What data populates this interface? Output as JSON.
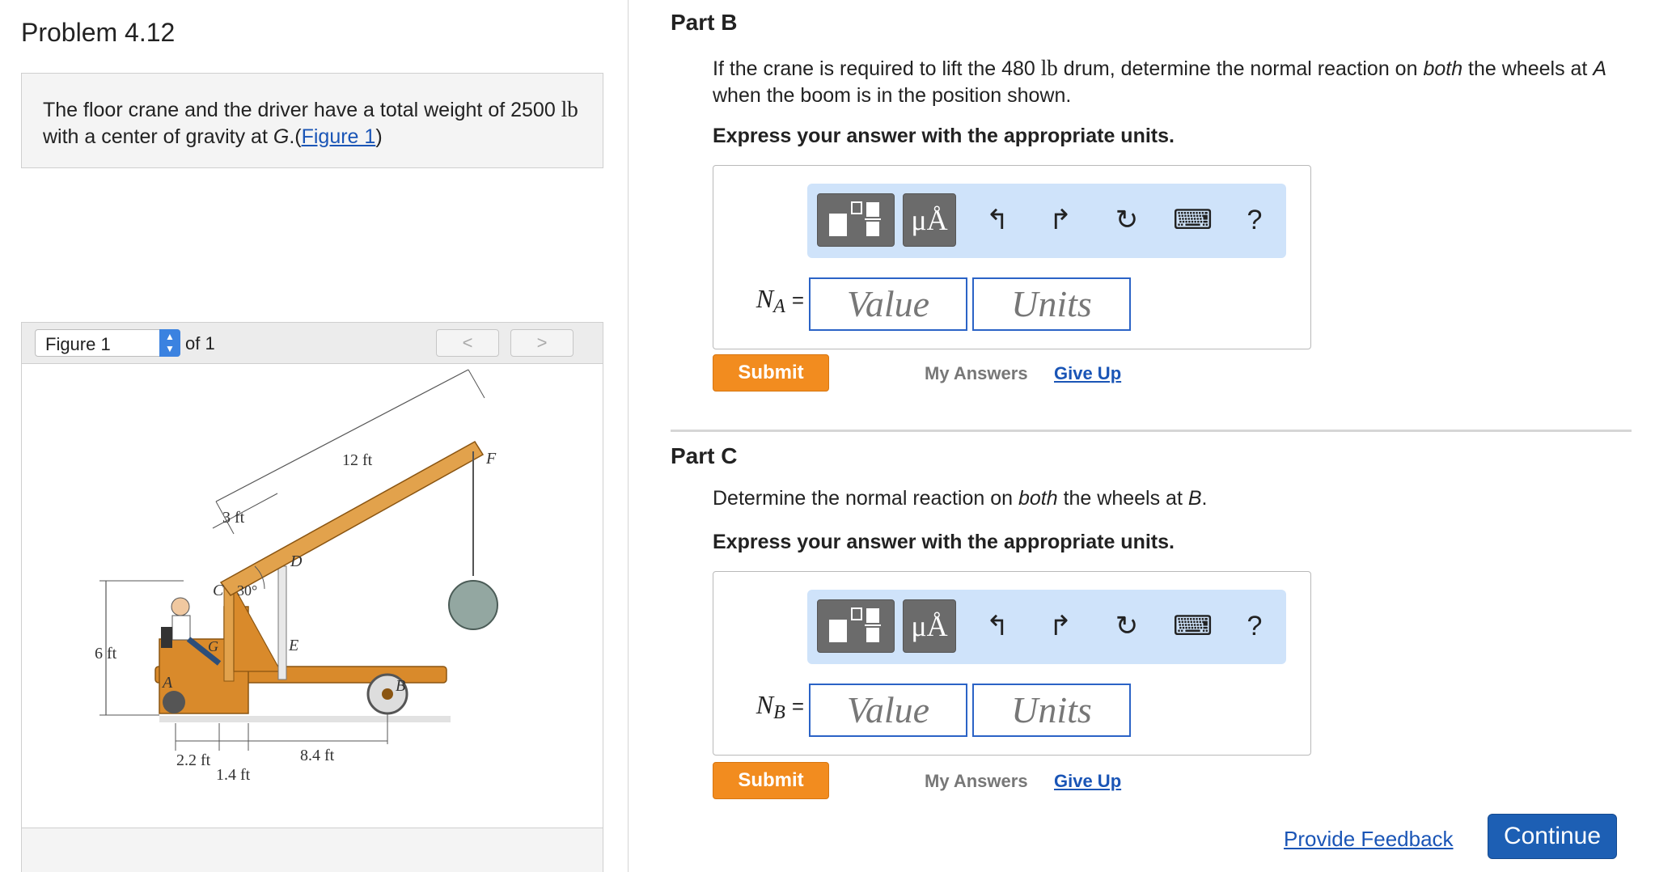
{
  "problem": {
    "title": "Problem 4.12",
    "statement_part1": "The floor crane and the driver have a total weight of 2500",
    "statement_unit": "lb",
    "statement_part2": " with a center of gravity at ",
    "statement_g": "G",
    "statement_part3": ".(",
    "figure_link": "Figure 1",
    "statement_part4": ")"
  },
  "figure_viewer": {
    "selected_figure": "Figure 1",
    "of_label": "of 1",
    "prev_glyph": "<",
    "next_glyph": ">",
    "labels": {
      "dim_12ft": "12 ft",
      "dim_3ft": "3 ft",
      "dim_6ft": "6 ft",
      "dim_30": "30°",
      "dim_22ft": "2.2 ft",
      "dim_14ft": "1.4 ft",
      "dim_84ft": "8.4 ft",
      "pt_f": "F",
      "pt_d": "D",
      "pt_c": "C",
      "pt_g": "G",
      "pt_e": "E",
      "pt_a": "A",
      "pt_b": "B"
    }
  },
  "part_b": {
    "title": "Part B",
    "q1": "If the crane is required to lift the 480 ",
    "q_unit": "lb",
    "q2": " drum, determine the normal reaction on ",
    "q_both": "both",
    "q3": " the wheels at ",
    "q_a": "A",
    "q4": " when the boom is in the position shown.",
    "express": "Express your answer with the appropriate units.",
    "var_letter": "N",
    "var_sub": "A",
    "eq": "=",
    "value_placeholder": "Value",
    "units_placeholder": "Units",
    "submit": "Submit",
    "my_answers": "My Answers",
    "give_up": "Give Up"
  },
  "part_c": {
    "title": "Part C",
    "q1": "Determine the normal reaction on ",
    "q_both": "both",
    "q2": " the wheels at ",
    "q_b": "B",
    "q3": ".",
    "express": "Express your answer with the appropriate units.",
    "var_letter": "N",
    "var_sub": "B",
    "eq": "=",
    "value_placeholder": "Value",
    "units_placeholder": "Units",
    "submit": "Submit",
    "my_answers": "My Answers",
    "give_up": "Give Up"
  },
  "toolbar": {
    "mu_label": "μÅ",
    "undo_glyph": "↰",
    "redo_glyph": "↱",
    "reset_glyph": "↻",
    "keyboard_glyph": "⌨",
    "help_glyph": "?"
  },
  "footer": {
    "feedback": "Provide Feedback",
    "continue": "Continue"
  },
  "colors": {
    "accent_orange": "#f28c1f",
    "link_blue": "#1a55b6",
    "continue_blue": "#1d5fb4",
    "toolbar_bg": "#cfe3fa",
    "crane_body": "#d98a2b"
  }
}
